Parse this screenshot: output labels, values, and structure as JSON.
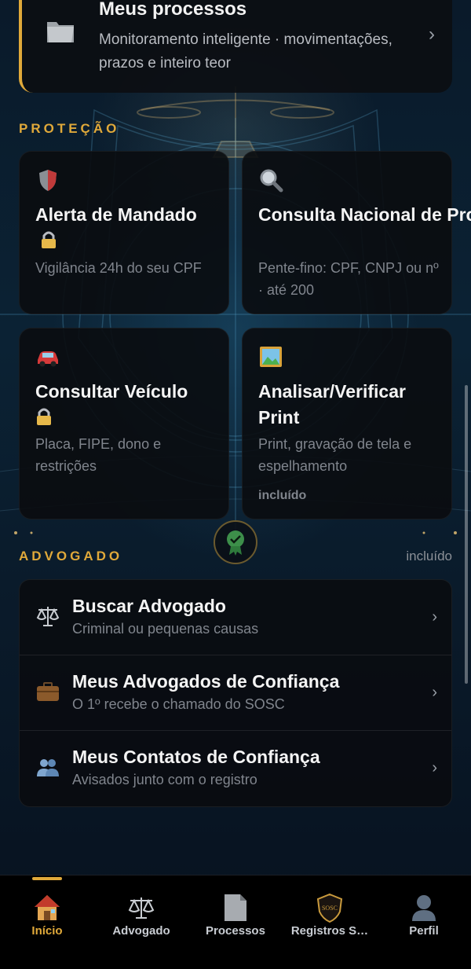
{
  "processes": {
    "title": "Meus processos",
    "subtitle": "Monitoramento inteligente · movimentações, prazos e inteiro teor"
  },
  "protection": {
    "label": "PROTEÇÃO",
    "tiles": [
      {
        "title": "Alerta de Mandado",
        "subtitle": "Vigilância 24h do seu CPF",
        "icon": "shield-icon",
        "locked": true
      },
      {
        "title": "Consulta Nacional de Pro…",
        "subtitle": "Pente-fino: CPF, CNPJ ou nº · até 200",
        "icon": "magnifier-icon",
        "locked": false
      },
      {
        "title": "Consultar Veículo",
        "subtitle": "Placa, FIPE, dono e restrições",
        "icon": "car-icon",
        "locked": true
      },
      {
        "title": "Analisar/Verificar Print",
        "subtitle": "Print, gravação de tela e espelhamento",
        "included": "incluído",
        "icon": "picture-icon",
        "locked": false
      }
    ]
  },
  "lawyer": {
    "label": "ADVOGADO",
    "included": "incluído",
    "items": [
      {
        "title": "Buscar Advogado",
        "subtitle": "Criminal ou pequenas causas",
        "icon": "scales-icon"
      },
      {
        "title": "Meus Advogados de Confiança",
        "subtitle": "O 1º recebe o chamado do SOSC",
        "icon": "briefcase-icon"
      },
      {
        "title": "Meus Contatos de Confiança",
        "subtitle": "Avisados junto com o registro",
        "icon": "people-icon"
      }
    ]
  },
  "tabs": [
    {
      "label": "Início",
      "icon": "house-icon",
      "active": true
    },
    {
      "label": "Advogado",
      "icon": "scales-icon"
    },
    {
      "label": "Processos",
      "icon": "document-icon"
    },
    {
      "label": "Registros S…",
      "icon": "sosc-badge-icon"
    },
    {
      "label": "Perfil",
      "icon": "person-icon"
    }
  ],
  "colors": {
    "accent": "#e0a93a",
    "background": "#07111e",
    "card": "#0a0c10"
  }
}
